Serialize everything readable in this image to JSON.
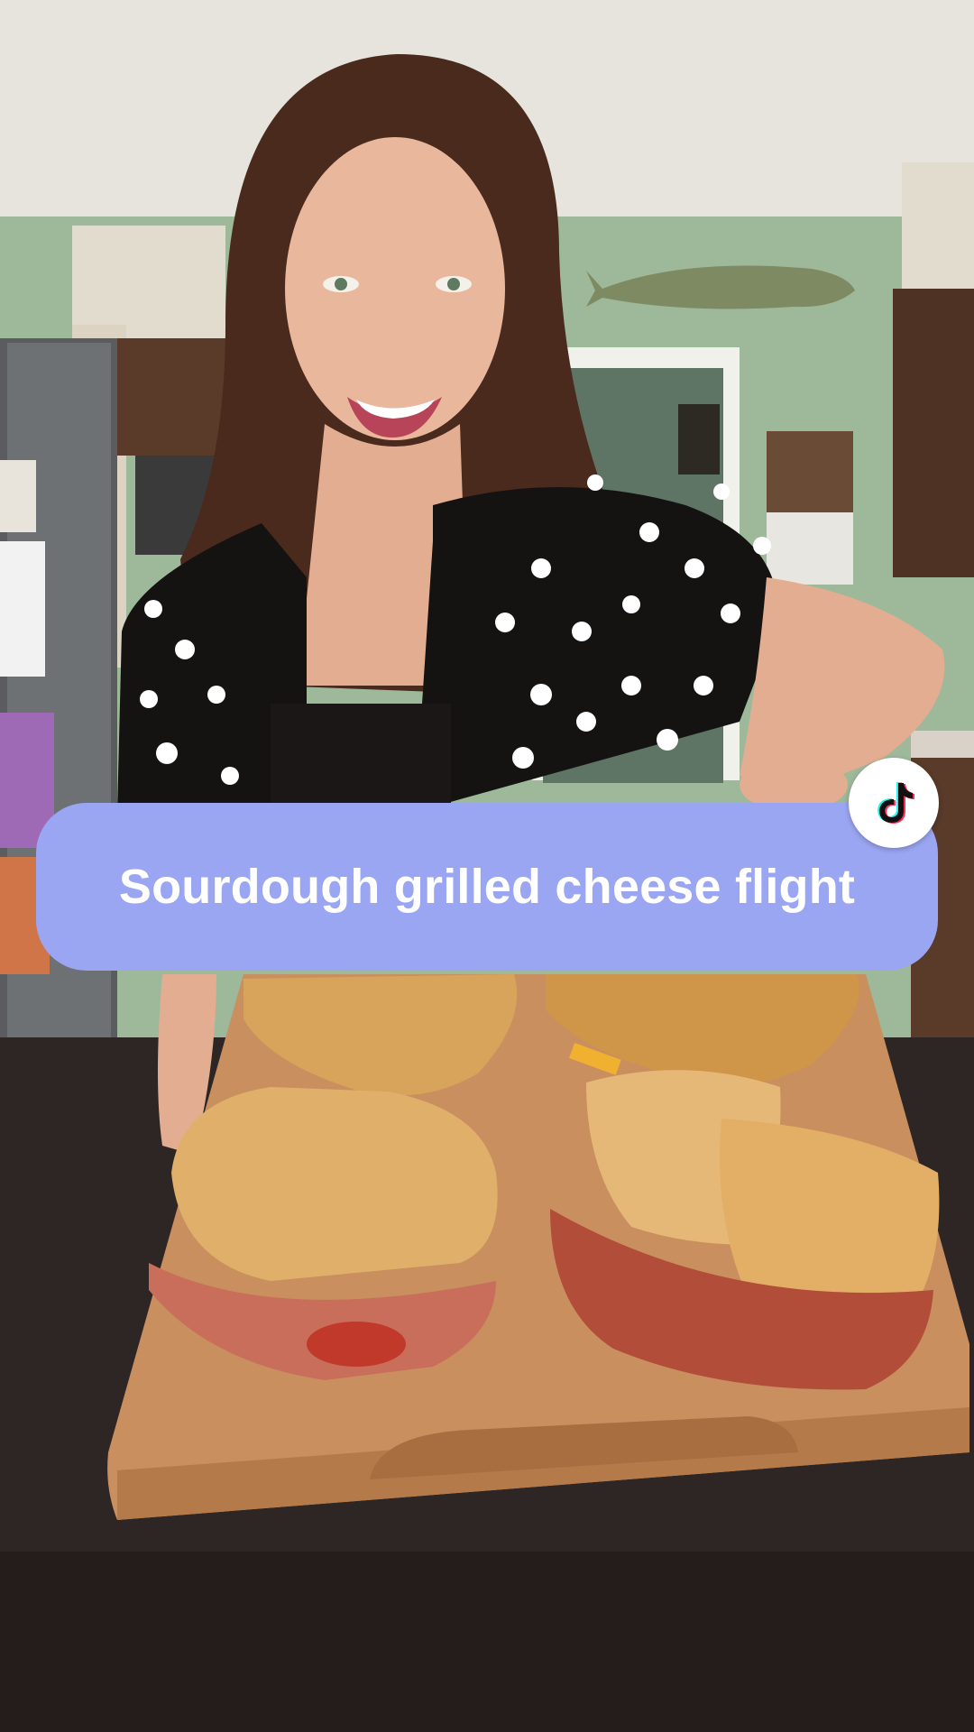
{
  "caption": {
    "text": "Sourdough grilled cheese flight",
    "background": "#9BA6F2",
    "text_color": "#FFFFFF"
  },
  "badge": {
    "icon": "tiktok-logo-icon"
  },
  "colors": {
    "ceiling": "#E6E4DC",
    "wall": "#9EB89A",
    "cabinet": "#5A3A28",
    "table": "#2E2624",
    "board": "#C98F5E",
    "toast": "#D8A35A",
    "hair": "#4A2A1C",
    "skin": "#E9B79C",
    "shirt": "#151212"
  }
}
